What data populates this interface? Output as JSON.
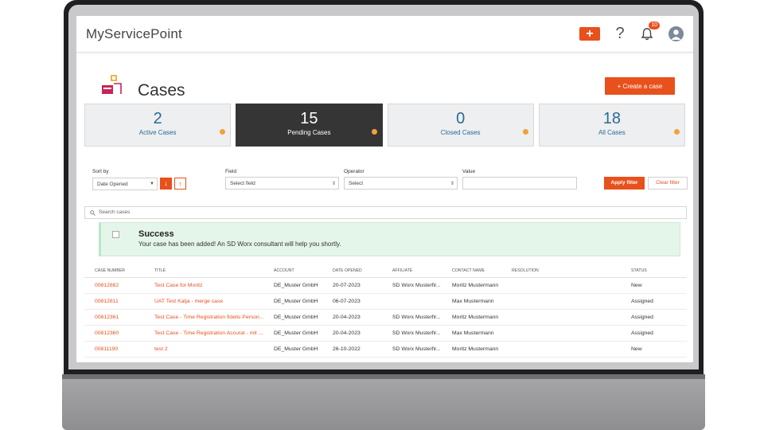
{
  "header": {
    "app_title": "MyServicePoint",
    "notifications_count": "10"
  },
  "page": {
    "title": "Cases",
    "create_label": "+ Create a case"
  },
  "stats": [
    {
      "value": "2",
      "label": "Active Cases"
    },
    {
      "value": "15",
      "label": "Pending Cases"
    },
    {
      "value": "0",
      "label": "Closed Cases"
    },
    {
      "value": "18",
      "label": "All Cases"
    }
  ],
  "filters": {
    "sort_by_label": "Sort by",
    "sort_by_value": "Date Opened",
    "field_label": "Field",
    "field_value": "Select field",
    "operator_label": "Operator",
    "operator_value": "Select",
    "value_label": "Value",
    "value_value": "",
    "apply_label": "Apply filter",
    "clear_label": "Clear filter"
  },
  "search": {
    "placeholder": "Search cases"
  },
  "alert": {
    "title": "Success",
    "message": "Your case has been added! An SD Worx consultant will help you shortly."
  },
  "table": {
    "columns": [
      "Case Number",
      "Title",
      "Account",
      "Date Opened",
      "Affiliate",
      "Contact Name",
      "Resolution",
      "Status"
    ],
    "rows": [
      {
        "case_number": "00812882",
        "title": "Test Case for Moritz",
        "account": "DE_Muster GmbH",
        "date_opened": "20-07-2023",
        "affiliate": "SD Worx Musterfir...",
        "contact": "Moritz Mustermann",
        "resolution": "",
        "status": "New"
      },
      {
        "case_number": "00812811",
        "title": "UAT Test Katja - merge case",
        "account": "DE_Muster GmbH",
        "date_opened": "06-07-2023",
        "affiliate": "",
        "contact": "Max Mustermann",
        "resolution": "",
        "status": "Assigned"
      },
      {
        "case_number": "00812361",
        "title": "Test Case - Time Registration fidelis Person...",
        "account": "DE_Muster GmbH",
        "date_opened": "20-04-2023",
        "affiliate": "SD Worx Musterfir...",
        "contact": "Moritz Mustermann",
        "resolution": "",
        "status": "Assigned"
      },
      {
        "case_number": "00812360",
        "title": "Test Case - Time Registration Accurat - mit ...",
        "account": "DE_Muster GmbH",
        "date_opened": "20-04-2023",
        "affiliate": "SD Worx Musterfir...",
        "contact": "Max Mustermann",
        "resolution": "",
        "status": "Assigned"
      },
      {
        "case_number": "00811190",
        "title": "test 2",
        "account": "DE_Muster GmbH",
        "date_opened": "26-10-2022",
        "affiliate": "SD Worx Musterfir...",
        "contact": "Moritz Mustermann",
        "resolution": "",
        "status": "New"
      }
    ]
  },
  "colors": {
    "accent": "#e8501c",
    "stat_text": "#2a6a96",
    "dark_card": "#353535",
    "success_bg": "#e4f5ea"
  }
}
